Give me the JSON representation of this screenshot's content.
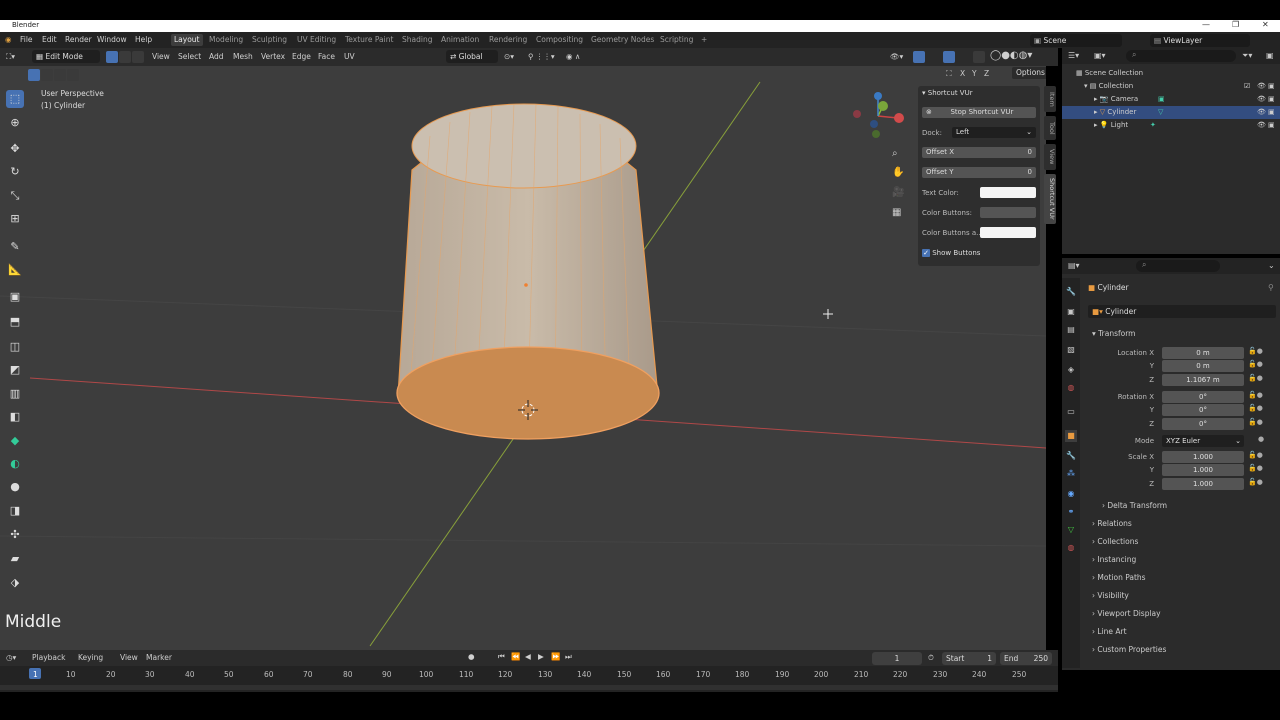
{
  "window": {
    "title": "Blender",
    "controls": [
      "—",
      "❐",
      "✕"
    ]
  },
  "menu": {
    "items": [
      "File",
      "Edit",
      "Render",
      "Window",
      "Help"
    ]
  },
  "workspaces": [
    "Layout",
    "Modeling",
    "Sculpting",
    "UV Editing",
    "Texture Paint",
    "Shading",
    "Animation",
    "Rendering",
    "Compositing",
    "Geometry Nodes",
    "Scripting",
    "+"
  ],
  "scene": {
    "name": "Scene",
    "view_layer": "ViewLayer"
  },
  "viewport_header": {
    "mode": "Edit Mode",
    "menus": [
      "View",
      "Select",
      "Add",
      "Mesh",
      "Vertex",
      "Edge",
      "Face",
      "UV"
    ],
    "transform": "Global",
    "axes": [
      "X",
      "Y",
      "Z"
    ],
    "options": "Options"
  },
  "viewport": {
    "perspective": "User Perspective",
    "object": "(1) Cylinder",
    "gizmo_labels": [
      "X",
      "Y",
      "Z"
    ],
    "overlay_text": "Middle"
  },
  "npanel": {
    "title": "Shortcut VUr",
    "stop_button": "Stop Shortcut VUr",
    "dock_label": "Dock:",
    "dock_value": "Left",
    "offset_x_label": "Offset X",
    "offset_x_value": "0",
    "offset_y_label": "Offset Y",
    "offset_y_value": "0",
    "text_color_label": "Text Color:",
    "color_buttons_label": "Color Buttons:",
    "color_buttons_a_label": "Color Buttons a..",
    "show_buttons_label": "Show Buttons",
    "tabs": [
      "Item",
      "Tool",
      "View",
      "Shortcut VUr"
    ]
  },
  "outliner": {
    "root": "Scene Collection",
    "collection": "Collection",
    "items": [
      "Camera",
      "Cylinder",
      "Light"
    ]
  },
  "properties": {
    "object_name": "Cylinder",
    "data_name": "Cylinder",
    "transform_title": "Transform",
    "location_x_label": "Location X",
    "location_x": "0 m",
    "location_y_label": "Y",
    "location_y": "0 m",
    "location_z_label": "Z",
    "location_z": "1.1067 m",
    "rotation_x_label": "Rotation X",
    "rotation_x": "0°",
    "rotation_y_label": "Y",
    "rotation_y": "0°",
    "rotation_z_label": "Z",
    "rotation_z": "0°",
    "mode_label": "Mode",
    "mode_value": "XYZ Euler",
    "scale_x_label": "Scale X",
    "scale_x": "1.000",
    "scale_y_label": "Y",
    "scale_y": "1.000",
    "scale_z_label": "Z",
    "scale_z": "1.000",
    "sections": [
      "Delta Transform",
      "Relations",
      "Collections",
      "Instancing",
      "Motion Paths",
      "Visibility",
      "Viewport Display",
      "Line Art",
      "Custom Properties"
    ]
  },
  "timeline": {
    "menus": [
      "Playback",
      "Keying",
      "View",
      "Marker"
    ],
    "current_frame": "1",
    "start_label": "Start",
    "start": "1",
    "end_label": "End",
    "end": "250",
    "ticks": [
      "1",
      "10",
      "20",
      "30",
      "40",
      "50",
      "60",
      "70",
      "80",
      "90",
      "100",
      "110",
      "120",
      "130",
      "140",
      "150",
      "160",
      "170",
      "180",
      "190",
      "200",
      "210",
      "220",
      "230",
      "240",
      "250"
    ]
  },
  "colors": {
    "accent": "#4772b3",
    "selection_orange": "#e8893a",
    "x_axis": "#c44a4a",
    "y_axis": "#8aa83a"
  }
}
